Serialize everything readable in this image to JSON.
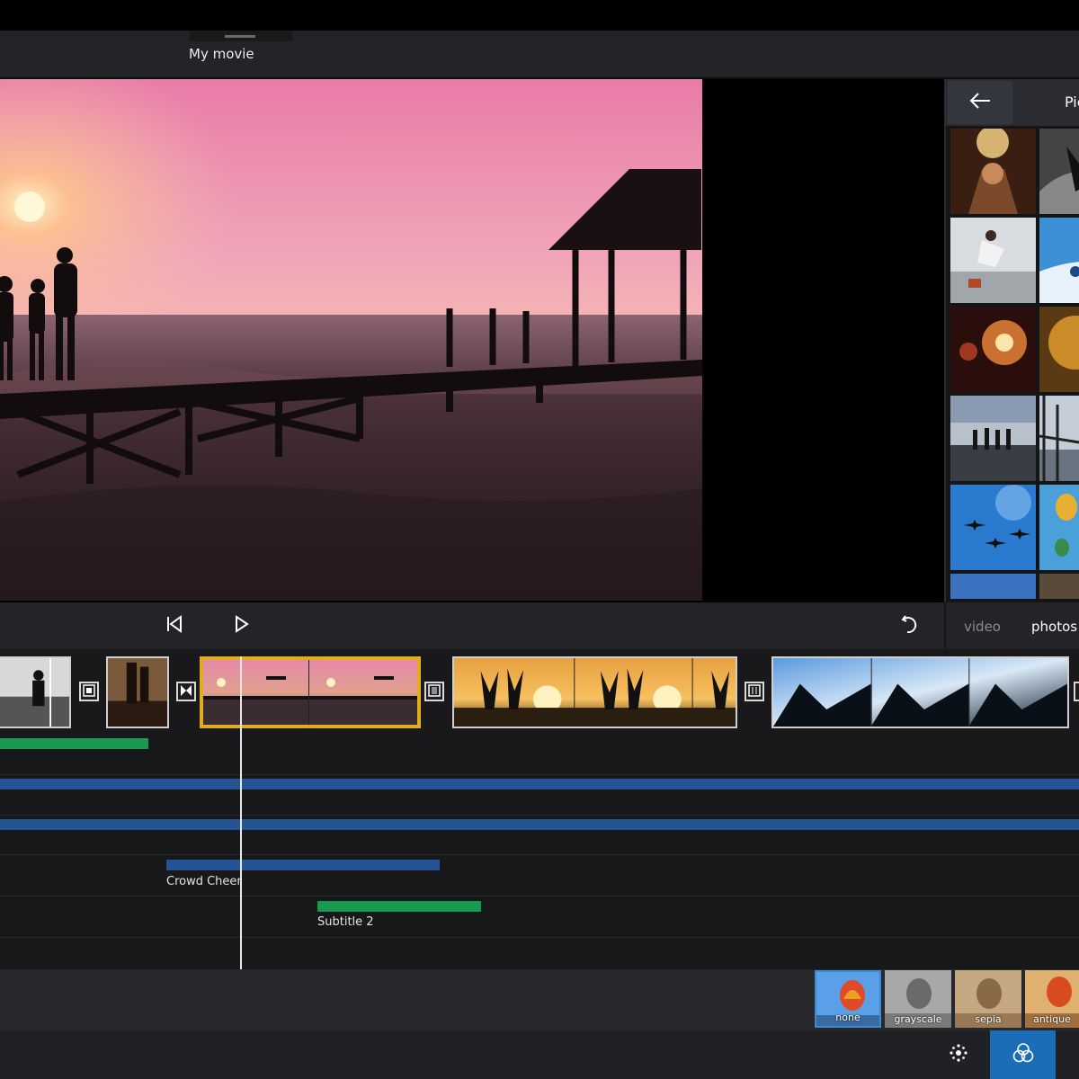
{
  "app": {
    "title": "My movie"
  },
  "library": {
    "title": "Pictures",
    "back_icon": "arrow-left-icon"
  },
  "transport": {
    "skip_back_icon": "skip-to-start-icon",
    "play_icon": "play-icon",
    "undo_icon": "undo-icon"
  },
  "media_tabs": [
    {
      "label": "video",
      "selected": false
    },
    {
      "label": "photos",
      "selected": true
    }
  ],
  "tracks": {
    "audio_clip": {
      "label": "Crowd Cheer"
    },
    "subtitle_clip": {
      "label": "Subtitle 2"
    }
  },
  "filters": [
    {
      "label": "none",
      "selected": true
    },
    {
      "label": "grayscale",
      "selected": false
    },
    {
      "label": "sepia",
      "selected": false
    },
    {
      "label": "antique",
      "selected": false
    }
  ],
  "bottom_bar": {
    "effects_icon": "sparkle-dots-icon",
    "filters_icon": "color-filter-circles-icon"
  },
  "colors": {
    "accent": "#1b6db8",
    "selection": "#e0ad22",
    "track_green": "#1a9950",
    "track_blue": "#255495"
  }
}
